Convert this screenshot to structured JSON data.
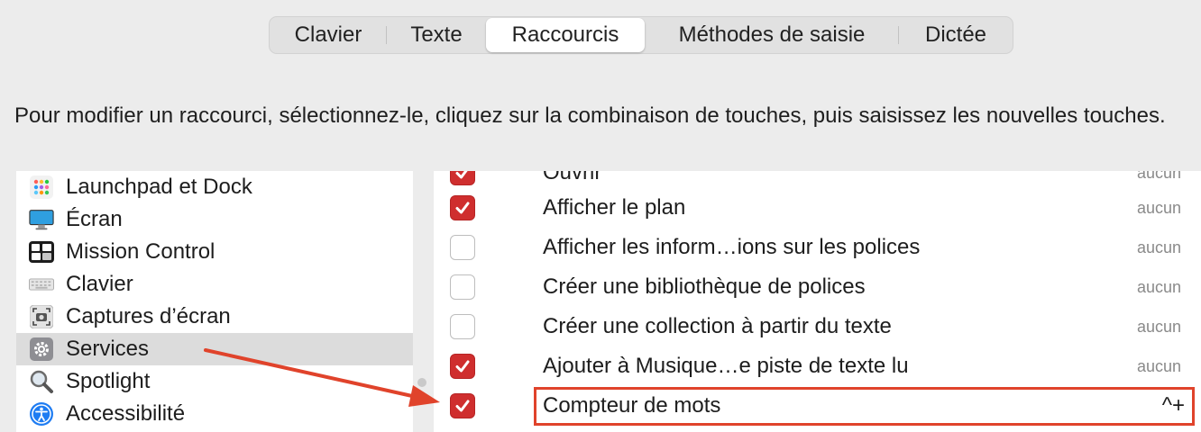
{
  "tabs": [
    "Clavier",
    "Texte",
    "Raccourcis",
    "Méthodes de saisie",
    "Dictée"
  ],
  "active_tab": "Raccourcis",
  "description": "Pour modifier un raccourci, sélectionnez-le, cliquez sur la combinaison de touches, puis saisissez les nouvelles touches.",
  "categories": [
    {
      "label": "Launchpad et Dock",
      "icon": "launchpad-icon"
    },
    {
      "label": "Écran",
      "icon": "display-icon"
    },
    {
      "label": "Mission Control",
      "icon": "mission-control-icon"
    },
    {
      "label": "Clavier",
      "icon": "keyboard-icon"
    },
    {
      "label": "Captures d’écran",
      "icon": "screenshot-icon"
    },
    {
      "label": "Services",
      "icon": "gear-icon",
      "selected": true
    },
    {
      "label": "Spotlight",
      "icon": "magnifier-icon"
    },
    {
      "label": "Accessibilité",
      "icon": "accessibility-icon"
    }
  ],
  "shortcuts": [
    {
      "title": "Ouvrir",
      "key": "aucun",
      "checked": true
    },
    {
      "title": "Afficher le plan",
      "key": "aucun",
      "checked": true
    },
    {
      "title": "Afficher les inform…ions sur les polices",
      "key": "aucun",
      "checked": false
    },
    {
      "title": "Créer une bibliothèque de polices",
      "key": "aucun",
      "checked": false
    },
    {
      "title": "Créer une collection à partir du texte",
      "key": "aucun",
      "checked": false
    },
    {
      "title": "Ajouter à Musique…e piste de texte lu",
      "key": "aucun",
      "checked": true
    },
    {
      "title": "Compteur de mots",
      "key": "^+",
      "checked": true,
      "highlighted": true
    }
  ],
  "colors": {
    "accent": "#cf2e2e",
    "annotation": "#e0432b",
    "selection": "#dcdcdc"
  }
}
